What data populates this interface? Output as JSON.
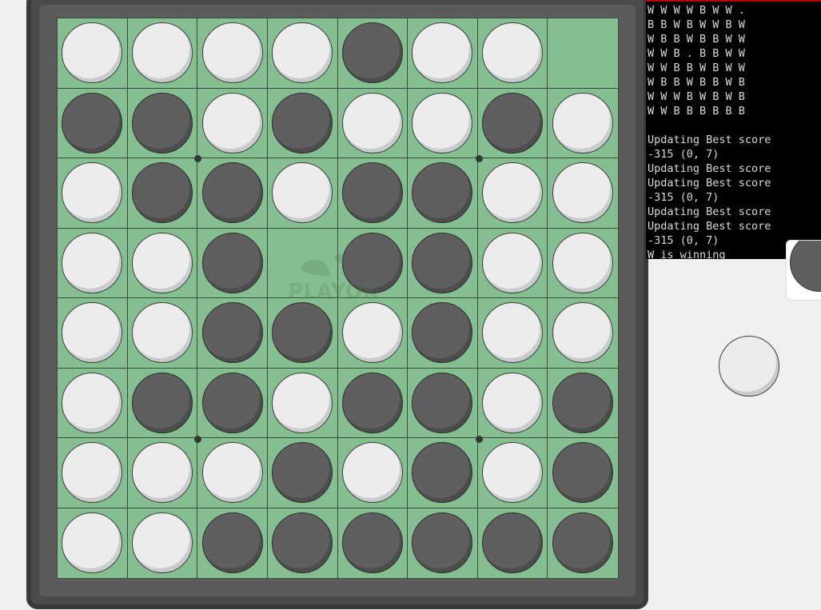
{
  "board": {
    "rows": [
      [
        "W",
        "W",
        "W",
        "W",
        "B",
        "W",
        "W",
        "."
      ],
      [
        "B",
        "B",
        "W",
        "B",
        "W",
        "W",
        "B",
        "W"
      ],
      [
        "W",
        "B",
        "B",
        "W",
        "B",
        "B",
        "W",
        "W"
      ],
      [
        "W",
        "W",
        "B",
        ".",
        "B",
        "B",
        "W",
        "W"
      ],
      [
        "W",
        "W",
        "B",
        "B",
        "W",
        "B",
        "W",
        "W"
      ],
      [
        "W",
        "B",
        "B",
        "W",
        "B",
        "B",
        "W",
        "B"
      ],
      [
        "W",
        "W",
        "W",
        "B",
        "W",
        "B",
        "W",
        "B"
      ],
      [
        "W",
        "W",
        "B",
        "B",
        "B",
        "B",
        "B",
        "B"
      ]
    ],
    "colors": {
      "board_green": "#85bf91",
      "white_disc": "#ececec",
      "black_disc": "#5f5f5f",
      "frame": "#4a4a4a"
    }
  },
  "watermark": {
    "text": "PLAYOK"
  },
  "terminal": {
    "lines": [
      "W W W W B W W .",
      "B B W B W W B W",
      "W B B W B B W W",
      "W W B . B B W W",
      "W W B B W B W W",
      "W B B W B B W B",
      "W W W B W B W B",
      "W W B B B B B B",
      "",
      "Updating Best score",
      "-315 (0, 7)",
      "Updating Best score",
      "Updating Best score",
      "-315 (0, 7)",
      "Updating Best score",
      "Updating Best score",
      "-315 (0, 7)",
      "W is winning"
    ]
  },
  "side_panel": {
    "current_turn_disc": "white-disc-icon",
    "card_disc": "black-disc-icon"
  }
}
